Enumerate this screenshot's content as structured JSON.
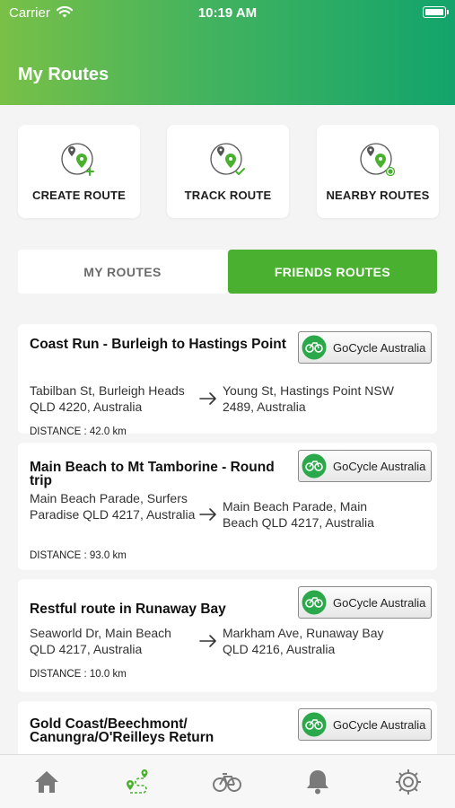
{
  "status_bar": {
    "carrier": "Carrier",
    "time": "10:19 AM"
  },
  "header": {
    "title": "My Routes"
  },
  "actions": [
    {
      "label": "CREATE ROUTE",
      "icon": "create-route-icon"
    },
    {
      "label": "TRACK ROUTE",
      "icon": "track-route-icon"
    },
    {
      "label": "NEARBY ROUTES",
      "icon": "nearby-routes-icon"
    }
  ],
  "tabs": {
    "my_routes": "MY ROUTES",
    "friends_routes": "FRIENDS ROUTES",
    "selected": "friends_routes"
  },
  "routes": [
    {
      "title": "Coast Run - Burleigh to Hastings Point",
      "brand": "GoCycle Australia",
      "from": "Tabilban St, Burleigh Heads QLD 4220, Australia",
      "to": "Young St, Hastings Point NSW 2489, Australia",
      "distance": "DISTANCE : 42.0 km"
    },
    {
      "title": "Main Beach to Mt Tamborine - Round trip",
      "brand": "GoCycle Australia",
      "from": "Main Beach Parade, Surfers Paradise QLD 4217, Australia",
      "to": "Main Beach Parade, Main Beach QLD 4217, Australia",
      "distance": "DISTANCE : 93.0 km"
    },
    {
      "title": "Restful route in Runaway Bay",
      "brand": "GoCycle Australia",
      "from": "Seaworld Dr, Main Beach QLD 4217, Australia",
      "to": "Markham Ave, Runaway Bay QLD 4216, Australia",
      "distance": "DISTANCE : 10.0 km"
    },
    {
      "title": "Gold Coast/Beechmont/ Canungra/O'Reilleys Return",
      "brand": "GoCycle Australia"
    }
  ],
  "tab_bar": [
    {
      "icon": "home-icon"
    },
    {
      "icon": "routes-icon",
      "active": true
    },
    {
      "icon": "bicycle-icon"
    },
    {
      "icon": "bell-icon"
    },
    {
      "icon": "gear-icon"
    }
  ],
  "colors": {
    "header_start": "#79c047",
    "header_end": "#12a46c",
    "accent": "#49b12f",
    "brand_green": "#2aa84a"
  }
}
